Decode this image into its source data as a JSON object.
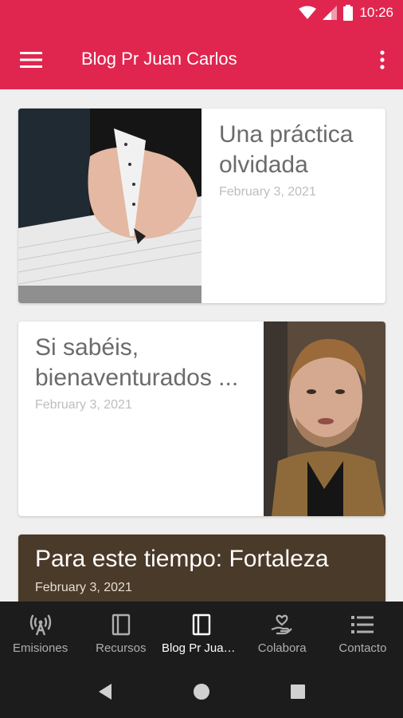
{
  "status": {
    "time": "10:26"
  },
  "app_bar": {
    "title": "Blog Pr Juan Carlos"
  },
  "posts": [
    {
      "title": "Una práctica olvidada",
      "date": "February 3, 2021"
    },
    {
      "title": "Si sabéis, bienaventurados ...",
      "date": "February 3, 2021"
    },
    {
      "title": "Para este tiempo: Fortaleza",
      "date": "February 3, 2021"
    }
  ],
  "nav": {
    "items": [
      {
        "label": "Emisiones",
        "icon": "antenna-icon"
      },
      {
        "label": "Recursos",
        "icon": "book-icon"
      },
      {
        "label": "Blog Pr Juan Carlos",
        "icon": "book-icon"
      },
      {
        "label": "Colabora",
        "icon": "donate-hand-icon"
      },
      {
        "label": "Contacto",
        "icon": "list-icon"
      }
    ],
    "active_index": 2
  },
  "colors": {
    "accent": "#e0264f",
    "nav_bg": "#1c1c1c"
  }
}
